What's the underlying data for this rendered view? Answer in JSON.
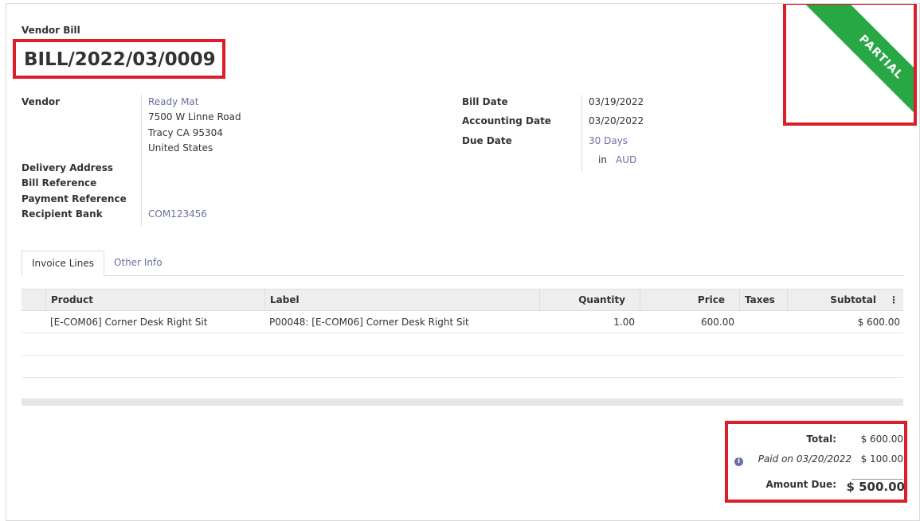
{
  "header": {
    "doc_type": "Vendor Bill",
    "doc_name": "BILL/2022/03/0009"
  },
  "status": {
    "ribbon": "PARTIAL",
    "color": "#28a745"
  },
  "left_fields": {
    "vendor_label": "Vendor",
    "vendor_name": "Ready Mat",
    "address_line1": "7500 W Linne Road",
    "address_line2": "Tracy CA 95304",
    "address_line3": "United States",
    "delivery_label": "Delivery Address",
    "bill_ref_label": "Bill Reference",
    "payment_ref_label": "Payment Reference",
    "recipient_bank_label": "Recipient Bank",
    "recipient_bank_value": "COM123456"
  },
  "right_fields": {
    "bill_date_label": "Bill Date",
    "bill_date_value": "03/19/2022",
    "accounting_date_label": "Accounting Date",
    "accounting_date_value": "03/20/2022",
    "due_date_label": "Due Date",
    "due_date_value": "30 Days",
    "in_label": "in",
    "currency": "AUD"
  },
  "tabs": [
    {
      "label": "Invoice Lines"
    },
    {
      "label": "Other Info"
    }
  ],
  "grid": {
    "headers": {
      "product": "Product",
      "label": "Label",
      "quantity": "Quantity",
      "price": "Price",
      "taxes": "Taxes",
      "subtotal": "Subtotal"
    },
    "rows": [
      {
        "product": "[E-COM06] Corner Desk Right Sit",
        "label": "P00048: [E-COM06] Corner Desk Right Sit",
        "quantity": "1.00",
        "price": "600.00",
        "taxes": "",
        "subtotal": "$ 600.00"
      }
    ]
  },
  "totals": {
    "total_label": "Total:",
    "total_value": "$ 600.00",
    "paid_label": "Paid on 03/20/2022",
    "paid_value": "$ 100.00",
    "due_label": "Amount Due:",
    "due_value": "$ 500.00"
  }
}
